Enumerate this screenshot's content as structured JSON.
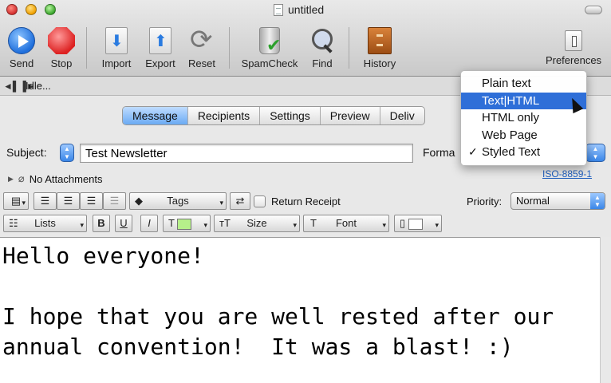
{
  "window": {
    "title": "untitled"
  },
  "toolbar": {
    "send": "Send",
    "stop": "Stop",
    "import": "Import",
    "export": "Export",
    "reset": "Reset",
    "spamcheck": "SpamCheck",
    "find": "Find",
    "history": "History",
    "preferences": "Preferences"
  },
  "status": {
    "text": "Idle..."
  },
  "tabs": [
    {
      "label": "Message",
      "active": true
    },
    {
      "label": "Recipients"
    },
    {
      "label": "Settings"
    },
    {
      "label": "Preview"
    },
    {
      "label": "Deliv"
    }
  ],
  "compose": {
    "subject_label": "Subject:",
    "subject_value": "Test Newsletter",
    "format_label": "Forma",
    "attachments": "No Attachments",
    "encoding": "ISO-8859-1"
  },
  "format_bar": {
    "tags": "Tags",
    "return_receipt": "Return Receipt",
    "priority_label": "Priority:",
    "priority_value": "Normal",
    "lists": "Lists",
    "bold": "B",
    "underline": "U",
    "italic": "I",
    "text_color_glyph": "T",
    "size_glyph": "ᴛT",
    "size": "Size",
    "font_glyph": "T",
    "font": "Font",
    "colors": {
      "text_color": "#b6f08a",
      "background_color": "#ffffff"
    }
  },
  "body": {
    "lines": [
      "Hello everyone!",
      "",
      "I hope that you are well rested after our",
      "annual convention!  It was a blast! :)"
    ]
  },
  "format_menu": {
    "items": [
      {
        "label": "Plain text",
        "highlighted": false,
        "checked": false
      },
      {
        "label": "Text|HTML",
        "highlighted": true,
        "checked": false
      },
      {
        "label": "HTML only",
        "highlighted": false,
        "checked": false
      },
      {
        "label": "Web Page",
        "highlighted": false,
        "checked": false
      },
      {
        "label": "Styled Text",
        "highlighted": false,
        "checked": true
      }
    ],
    "check_glyph": "✓"
  },
  "icons": {
    "send": "send-icon",
    "stop": "stop-icon",
    "import": "import-icon",
    "export": "export-icon",
    "reset": "reset-icon",
    "spamcheck": "trash-check-icon",
    "find": "magnifier-icon",
    "history": "cabinet-icon",
    "preferences": "switch-icon"
  },
  "accent": "#2f6fd8"
}
